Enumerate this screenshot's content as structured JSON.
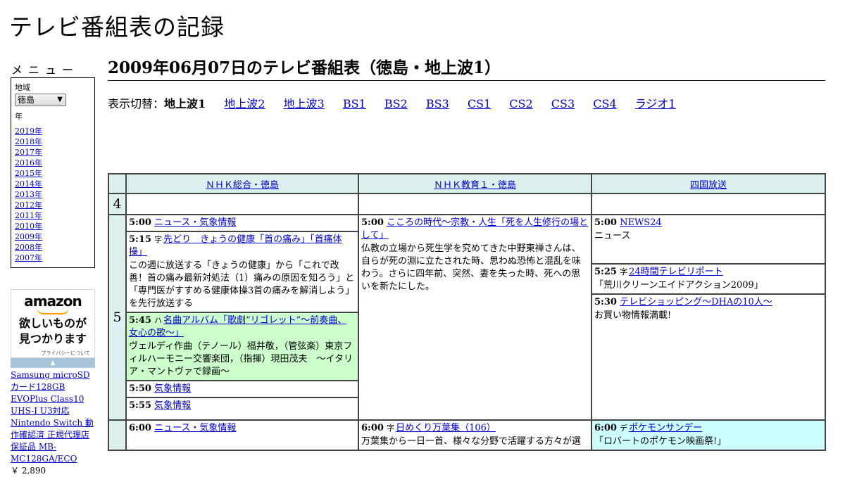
{
  "site": {
    "title": "テレビ番組表の記録"
  },
  "sidebar": {
    "menu_title": "メニュー",
    "region_label": "地域",
    "region_value": "徳島",
    "year_label": "年",
    "years": [
      "2019年",
      "2018年",
      "2017年",
      "2016年",
      "2015年",
      "2014年",
      "2013年",
      "2012年",
      "2011年",
      "2010年",
      "2009年",
      "2008年",
      "2007年"
    ]
  },
  "ad": {
    "logo": "amazon",
    "tagline_1": "欲しいものが",
    "tagline_2": "見つかります",
    "privacy": "プライバシーについて",
    "product": "Samsung microSDカード128GB EVOPlus Class10 UHS-I U3対応 Nintendo Switch 動作確認済 正規代理店保証品 MB-MC128GA/ECO",
    "price": "￥ 2,890"
  },
  "main": {
    "title": "2009年06月07日のテレビ番組表（徳島・地上波1）",
    "switch_label": "表示切替：",
    "current": "地上波1",
    "links": [
      "地上波2",
      "地上波3",
      "BS1",
      "BS2",
      "BS3",
      "CS1",
      "CS2",
      "CS3",
      "CS4",
      "ラジオ1"
    ]
  },
  "schedule": {
    "channels": [
      "ＮＨＫ総合・徳島",
      "ＮＨＫ教育１・徳島",
      "四国放送"
    ],
    "hours": [
      "4",
      "5"
    ],
    "col1": [
      {
        "time": "5:00",
        "title": "ニュース・気象情報",
        "desc": ""
      },
      {
        "time": "5:15",
        "title": "先どり　きょうの健康「首の痛み」「首痛体操」",
        "desc": "この週に放送する「きょうの健康」から「これで改善！首の痛み最新対処法（1）痛みの原因を知ろう」と「専門医がすすめる健康体操3首の痛みを解消しよう」を先行放送する"
      },
      {
        "time": "5:45",
        "title": "名曲アルバム「歌劇“リゴレット”～前奏曲、女心の歌～」",
        "desc": "ヴェルディ作曲（テノール）福井敬，（管弦楽）東京フィルハーモニー交響楽団，（指揮）現田茂夫　～イタリア・マントヴァで録画～"
      },
      {
        "time": "5:50",
        "title": "気象情報",
        "desc": ""
      },
      {
        "time": "5:55",
        "title": "気象情報",
        "desc": ""
      },
      {
        "time": "6:00",
        "title": "ニュース・気象情報",
        "desc": ""
      }
    ],
    "col2": [
      {
        "time": "5:00",
        "title": "こころの時代～宗教・人生「死を人生修行の場として」",
        "desc": "仏教の立場から死生学を究めてきた中野東禅さんは、自らが死の淵に立たされた時、思わぬ恐怖と混乱を味わう。さらに四年前、突然、妻を失った時、死への思いを新たにした。"
      },
      {
        "time": "6:00",
        "title": "日めくり万葉集（106）",
        "desc": "万葉集から一日一首、様々な分野で活躍する方々が選"
      }
    ],
    "col3": [
      {
        "time": "5:00",
        "title": "NEWS24",
        "desc": "ニュース"
      },
      {
        "time": "5:25",
        "title": "24時間テレビリポート",
        "desc": "「荒川クリーンエイドアクション2009」"
      },
      {
        "time": "5:30",
        "title": "テレビショッピング～DHAの10人～",
        "desc": "お買い物情報満載!"
      },
      {
        "time": "6:00",
        "title": "ポケモンサンデー",
        "desc": "「ロバートのポケモン映画祭!」"
      }
    ],
    "colors": {
      "header_bg": "#ddf0f0",
      "music_bg": "#ccffcc",
      "anime_bg": "#ccffff",
      "link": "#0000cc"
    }
  }
}
